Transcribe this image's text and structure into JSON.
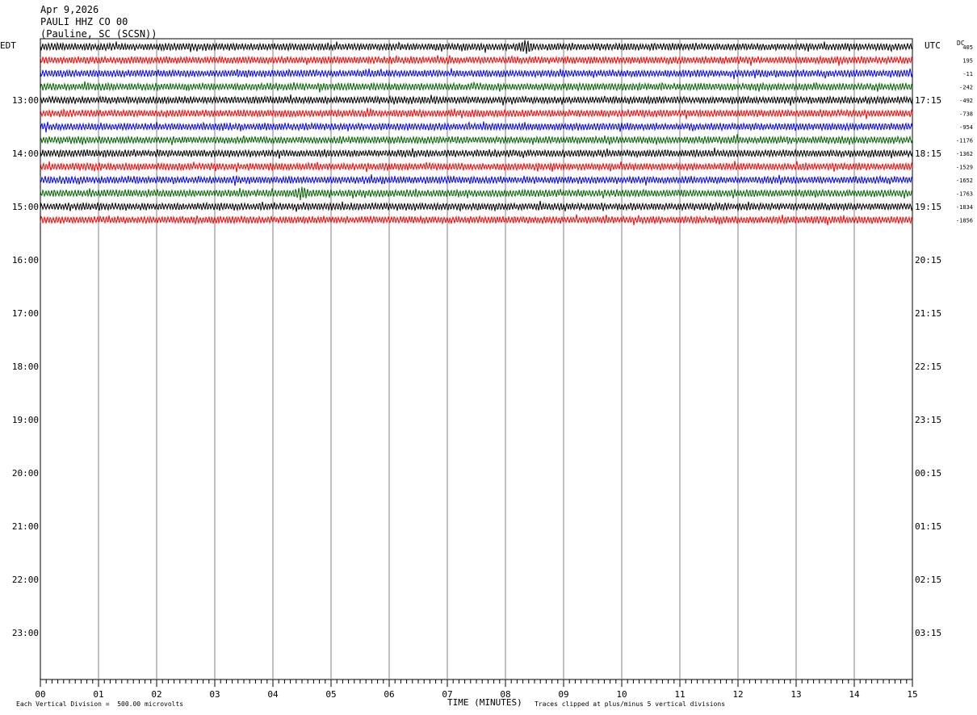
{
  "header": {
    "date": "Apr 9,2026",
    "station": "PAULI HHZ CO 00",
    "location": "(Pauline, SC (SCSN))"
  },
  "axis_labels": {
    "left_tz": "EDT",
    "right_tz": "UTC",
    "dc": "DC"
  },
  "footer": {
    "scale": "Each Vertical Division =  500.00 microvolts",
    "xlabel": "TIME (MINUTES)",
    "clip": "Traces clipped at plus/minus 5 vertical divisions"
  },
  "chart_data": {
    "type": "line",
    "title": "PAULI HHZ CO 00",
    "xlabel": "TIME (MINUTES)",
    "xlim": [
      0,
      15
    ],
    "x_ticks": [
      "00",
      "01",
      "02",
      "03",
      "04",
      "05",
      "06",
      "07",
      "08",
      "09",
      "10",
      "11",
      "12",
      "13",
      "14",
      "15"
    ],
    "left_hour_labels": [
      "13:00",
      "14:00",
      "15:00",
      "16:00",
      "17:00",
      "18:00",
      "19:00",
      "20:00",
      "21:00",
      "22:00",
      "23:00"
    ],
    "right_hour_labels": [
      "17:15",
      "18:15",
      "19:15",
      "20:15",
      "21:15",
      "22:15",
      "23:15",
      "00:15",
      "01:15",
      "02:15",
      "03:15"
    ],
    "trace_colors": [
      "#000000",
      "#ff0000",
      "#0000ff",
      "#006400"
    ],
    "traces_per_hour": 4,
    "trace_count": 14,
    "dc_offsets": [
      "405",
      "195",
      "-11",
      "-242",
      "-492",
      "-738",
      "-954",
      "-1176",
      "-1362",
      "-1529",
      "-1652",
      "-1763",
      "-1834",
      "-1856"
    ],
    "events": [
      {
        "trace": 0,
        "minute": 8.35
      },
      {
        "trace": 11,
        "minute": 4.5
      }
    ]
  }
}
